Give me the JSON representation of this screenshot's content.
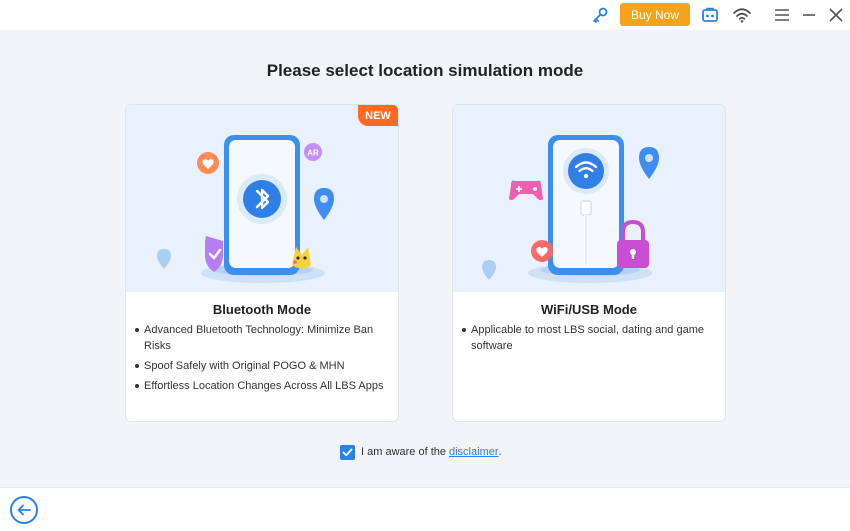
{
  "toolbar": {
    "buy_label": "Buy Now",
    "icons": [
      "key-icon",
      "toolbox-icon",
      "wifi-icon",
      "menu-icon",
      "minimize-icon",
      "close-icon"
    ]
  },
  "page": {
    "title": "Please select location simulation mode"
  },
  "cards": [
    {
      "badge": "NEW",
      "illustration_badge": "AR",
      "title": "Bluetooth Mode",
      "bullets": [
        "Advanced Bluetooth Technology: Minimize Ban Risks",
        "Spoof Safely with Original POGO & MHN",
        "Effortless Location Changes Across All LBS Apps"
      ]
    },
    {
      "title": "WiFi/USB Mode",
      "bullets": [
        "Applicable to most LBS social, dating and game software"
      ]
    }
  ],
  "agreement": {
    "checked": true,
    "text": "I am aware of the",
    "link": "disclaimer",
    "suffix": "."
  },
  "colors": {
    "accent": "#2a82e4",
    "buy": "#f7a21b",
    "badge": "#ff6a21"
  }
}
